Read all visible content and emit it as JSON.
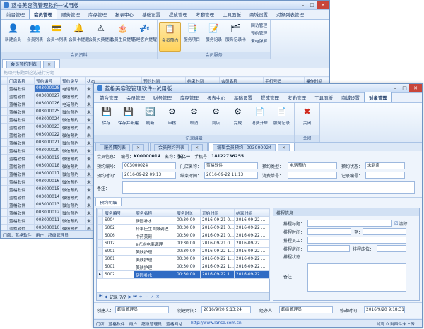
{
  "app_title": "蓝格美容院管理软件--试用版",
  "win_buttons": {
    "min": "–",
    "max": "□",
    "close": "✕"
  },
  "back": {
    "menu": [
      "前台管理",
      "会员管理",
      "财务管理",
      "库存管理",
      "报表中心",
      "基础设置",
      "提成管理",
      "考勤管理",
      "工具面板",
      "商城设置",
      "对象列表管理"
    ],
    "active_menu_index": 1,
    "ribbon_group1": [
      {
        "label": "新建会员",
        "icon": "👤"
      },
      {
        "label": "会员列表",
        "icon": "👥"
      },
      {
        "label": "会员卡列表",
        "icon": "💳"
      },
      {
        "label": "会员卡提醒",
        "icon": "🔔"
      },
      {
        "label": "会员欠费提醒",
        "icon": "⚠"
      },
      {
        "label": "会员生日提醒",
        "icon": "🎂"
      },
      {
        "label": "沉睡客户提醒",
        "icon": "💤"
      }
    ],
    "group1_caption": "会员资料",
    "ribbon_group2": [
      {
        "label": "会员预约",
        "icon": "📋",
        "selected": true
      },
      {
        "label": "服务项目",
        "icon": "📑"
      },
      {
        "label": "服务记录",
        "icon": "📝"
      },
      {
        "label": "服务记录卡",
        "icon": "🗂"
      }
    ],
    "group2_caption": "会员服务",
    "small_buttons": [
      "回访管理",
      "预约管理",
      "来电弹屏"
    ],
    "tab": "会员预约列表",
    "hint": "拖动列标题到这边进行分组",
    "columns": [
      "门店名称",
      "预约编号",
      "预约类型",
      "状态"
    ],
    "rows": [
      [
        "蓝格软件",
        "003000028",
        "电话预约",
        "未"
      ],
      [
        "蓝格软件",
        "003000027",
        "微信预约",
        "未"
      ],
      [
        "蓝格软件",
        "003000026",
        "电话预约",
        "未"
      ],
      [
        "蓝格软件",
        "003000025",
        "微信预约",
        "未"
      ],
      [
        "蓝格软件",
        "003000024",
        "微信预约",
        "未"
      ],
      [
        "蓝格软件",
        "003000023",
        "微信预约",
        "未"
      ],
      [
        "蓝格软件",
        "003000022",
        "微信预约",
        "未"
      ],
      [
        "蓝格软件",
        "003000021",
        "微信预约",
        "未"
      ],
      [
        "蓝格软件",
        "003000020",
        "微信预约",
        "未"
      ],
      [
        "蓝格软件",
        "003000019",
        "微信预约",
        "未"
      ],
      [
        "蓝格软件",
        "003000018",
        "微信预约",
        "未"
      ],
      [
        "蓝格软件",
        "003000017",
        "微信预约",
        "未"
      ],
      [
        "蓝格软件",
        "003000016",
        "微信预约",
        "未"
      ],
      [
        "蓝格软件",
        "003000015",
        "微信预约",
        "未"
      ],
      [
        "蓝格软件",
        "003000014",
        "微信预约",
        "未"
      ],
      [
        "蓝格软件",
        "003000013",
        "微信预约",
        "未"
      ],
      [
        "蓝格软件",
        "003000012",
        "微信预约",
        "未"
      ],
      [
        "蓝格软件",
        "003000011",
        "微信预约",
        "未"
      ],
      [
        "蓝格软件",
        "003000010",
        "微信预约",
        "未"
      ]
    ],
    "extra_columns": [
      "预约时间",
      "结束时间",
      "会员名称",
      "手机号码",
      "操作时间",
      "经办人"
    ],
    "status": [
      "门店：蓝格软件",
      "用户：超级管理员"
    ]
  },
  "front": {
    "menu": [
      "前台管理",
      "会员管理",
      "财务管理",
      "库存管理",
      "报表中心",
      "基础设置",
      "提成管理",
      "考勤管理",
      "工具面板",
      "商城设置",
      "对象管理"
    ],
    "active_menu_index": 10,
    "ribbon": [
      {
        "label": "保存",
        "icon": "💾"
      },
      {
        "label": "保存并新建",
        "icon": "💾"
      },
      {
        "label": "刷新",
        "icon": "🔄"
      },
      {
        "label": "审核",
        "icon": "⚙"
      },
      {
        "label": "取消",
        "icon": "⚙"
      },
      {
        "label": "到店",
        "icon": "⚙"
      },
      {
        "label": "完成",
        "icon": "⚙"
      },
      {
        "label": "消费开单",
        "icon": "📄"
      },
      {
        "label": "服务记录",
        "icon": "📄"
      }
    ],
    "ribbon_caption": "记录编辑",
    "close_btn": {
      "label": "关闭",
      "icon": "✖"
    },
    "close_caption": "关闭",
    "tabs": [
      "服务费列表",
      "会员预约列表",
      "编辑会员预约--003000024"
    ],
    "active_tab_index": 2,
    "member": {
      "label_info": "会员信息：",
      "label_no": "编号：",
      "no": "K00000014",
      "label_name": "名称：",
      "name": "张亿一",
      "label_phone": "手机号：",
      "phone": "18122736255"
    },
    "form": {
      "l_code": "预约编号：",
      "code": "003000024",
      "l_store": "门店名称：",
      "store": "蓝格软件",
      "l_type": "预约类型：",
      "type": "电话预约",
      "l_state": "预约状态：",
      "state": "未到店",
      "l_time": "预约时间：",
      "time": "2016-09-22 09:13",
      "l_end": "结束时间：",
      "end": "2016-09-22 11:13",
      "l_consume": "消费单号：",
      "l_record": "记录编号：",
      "l_remark": "备注："
    },
    "sub_tab": "预约明细",
    "detail_columns": [
      "服务编号",
      "服务名称",
      "服务时长",
      "开始时间",
      "结束时间"
    ],
    "detail_rows": [
      [
        "S004",
        "伊园补水",
        "00:30:00",
        "2016-09-21 0…",
        "2016-09-22 …"
      ],
      [
        "S002",
        "持率臣生白嫩调理",
        "00:30:00",
        "2016-09-21 0…",
        "2016-09-22 …"
      ],
      [
        "S006",
        "中药美颜",
        "00:30:00",
        "2016-09-21 0…",
        "2016-09-22 …"
      ],
      [
        "S012",
        "e光冰电离调理",
        "00:30:00",
        "2016-09-21 0…",
        "2016-09-22 …"
      ],
      [
        "S001",
        "美肤护理",
        "00:30:00",
        "2016-09-22 1…",
        "2016-09-22 …"
      ],
      [
        "S001",
        "美肤护理",
        "00:30:00",
        "2016-09-22 1…",
        "2016-09-22 …"
      ],
      [
        "S001",
        "美肤护理",
        "00:30:00",
        "2016-09-22 1…",
        "2016-09-22 …"
      ],
      [
        "S002",
        "伊园补水",
        "00:30:00",
        "2016-09-22 1…",
        "2016-09-22 …"
      ]
    ],
    "selected_row_index": 7,
    "nav_text": "记录 7/7",
    "sched": {
      "title": "排程信息",
      "l_label": "排程标题：",
      "clear": "清除",
      "l_time": "排程时间：",
      "to": "至：",
      "l_staff": "排程员工：",
      "l_room": "排程房间：",
      "l_unit": "排程床位：",
      "l_state": "排程状态：",
      "l_remark": "备注："
    },
    "footer": {
      "l_creator": "创建人：",
      "creator": "超级管理员",
      "l_created": "创建时间：",
      "created": "2016/9/20 9:13:24",
      "l_handler": "经办人：",
      "handler": "超级管理员",
      "l_modified": "修改时间：",
      "modified": "2016/9/20 9:18:31"
    },
    "status": [
      "门店：蓝格软件",
      "用户：超级管理员",
      "蓝格网站：",
      "http://www.lanse.com.cn"
    ],
    "status_right": "试有 0 剩四件未上传 ..."
  }
}
